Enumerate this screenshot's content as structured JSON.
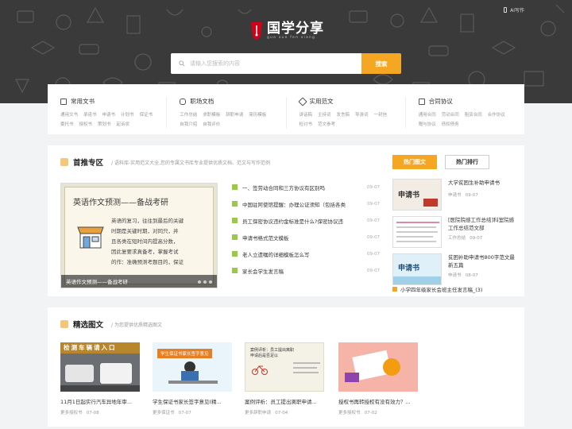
{
  "header": {
    "write_link": "AI写作"
  },
  "logo": {
    "name": "国学分享",
    "pinyin": "guo xue fen xiang"
  },
  "search": {
    "placeholder": "请输入您搜索的内容",
    "button": "搜索"
  },
  "categories": [
    {
      "title": "常用文书",
      "icon": "document-icon",
      "links": [
        "通用文书",
        "承诺书",
        "申请书",
        "计划书",
        "保证书",
        "委托书",
        "授权书",
        "策划书",
        "起诉状"
      ]
    },
    {
      "title": "职场文档",
      "icon": "chat-icon",
      "links": [
        "工作总结",
        "求职模板",
        "辞职申请",
        "简历模板",
        "自我介绍",
        "自我评价"
      ]
    },
    {
      "title": "实用范文",
      "icon": "tag-icon",
      "links": [
        "讲话稿",
        "主持词",
        "发言稿",
        "导游词",
        "一封信",
        "检讨书",
        "范文参考"
      ]
    },
    {
      "title": "合同协议",
      "icon": "contract-icon",
      "links": [
        "通用合同",
        "劳动合同",
        "租赁合同",
        "合作协议",
        "赠与协议",
        "债权债务"
      ]
    }
  ],
  "featured": {
    "title": "首推专区",
    "subtitle": "/ 语料库-实用范文大全,您的专属文书库专业提供优质文档、范文与写作范例",
    "banner": {
      "title": "英语作文预测——备战考研",
      "lines": [
        "英语的复习，往往到最后的关键",
        "时期是关键时期，对同只，并",
        "且各类在短时间内提高分数，",
        "因此复要求真备考，掌握考试",
        "的作：准确预测考题目的，保证"
      ],
      "caption": "英语作文预测——备战考研"
    },
    "news": [
      {
        "title": "一、签劳动合同和三方协议有区别吗",
        "date": "09-07"
      },
      {
        "title": "中国驻阿使馆提醒：办理公证须知（包括各类",
        "date": "09-07"
      },
      {
        "title": "员工保密协议违约金标准是什么?保密协议违",
        "date": "09-07"
      },
      {
        "title": "申请书格式范文模板",
        "date": "09-07"
      },
      {
        "title": "老人立遗嘱的详细模板怎么写",
        "date": "09-07"
      },
      {
        "title": "家长会学生发言稿",
        "date": "09-07"
      }
    ],
    "tabs": [
      "热门图文",
      "热门排行"
    ],
    "hot": [
      {
        "title": "大学贫困生补助申请书",
        "cat": "申请书",
        "date": "09-07",
        "thumb_text": "申请书"
      },
      {
        "title": "[医院院感工作总结]科室院感工作总结范文部",
        "cat": "工作总结",
        "date": "09-07",
        "thumb_text": ""
      },
      {
        "title": "贫困补助申请书800字范文最新五篇",
        "cat": "申请书",
        "date": "08-07",
        "thumb_text": "申请书"
      }
    ],
    "hot_last": "小学四年级家长会班主任发言稿_(3)"
  },
  "gallery": {
    "title": "精选图文",
    "subtitle": "/ 为您提供优质精选图文",
    "items": [
      {
        "title": "11月1日起实行汽车异地年审...",
        "cat": "更多授权书",
        "date": "07-08",
        "img_text": "检测车辆请入口"
      },
      {
        "title": "学生保证书家长签字意见(精...",
        "cat": "更多保证书",
        "date": "07-07",
        "img_text": "学生保证书家长签字意见"
      },
      {
        "title": "案例评析：员工提出离职申请...",
        "cat": "更多辞职申请",
        "date": "07-04",
        "img_text": "案例评析：员工提出离职申请后是否足以"
      },
      {
        "title": "授权书再转授权有没有效力？...",
        "cat": "更多授权书",
        "date": "07-02",
        "img_text": ""
      }
    ]
  },
  "colors": {
    "accent": "#f5a623",
    "news_icon": "#9bc84a",
    "hero_bg": "#3a3a3a"
  }
}
